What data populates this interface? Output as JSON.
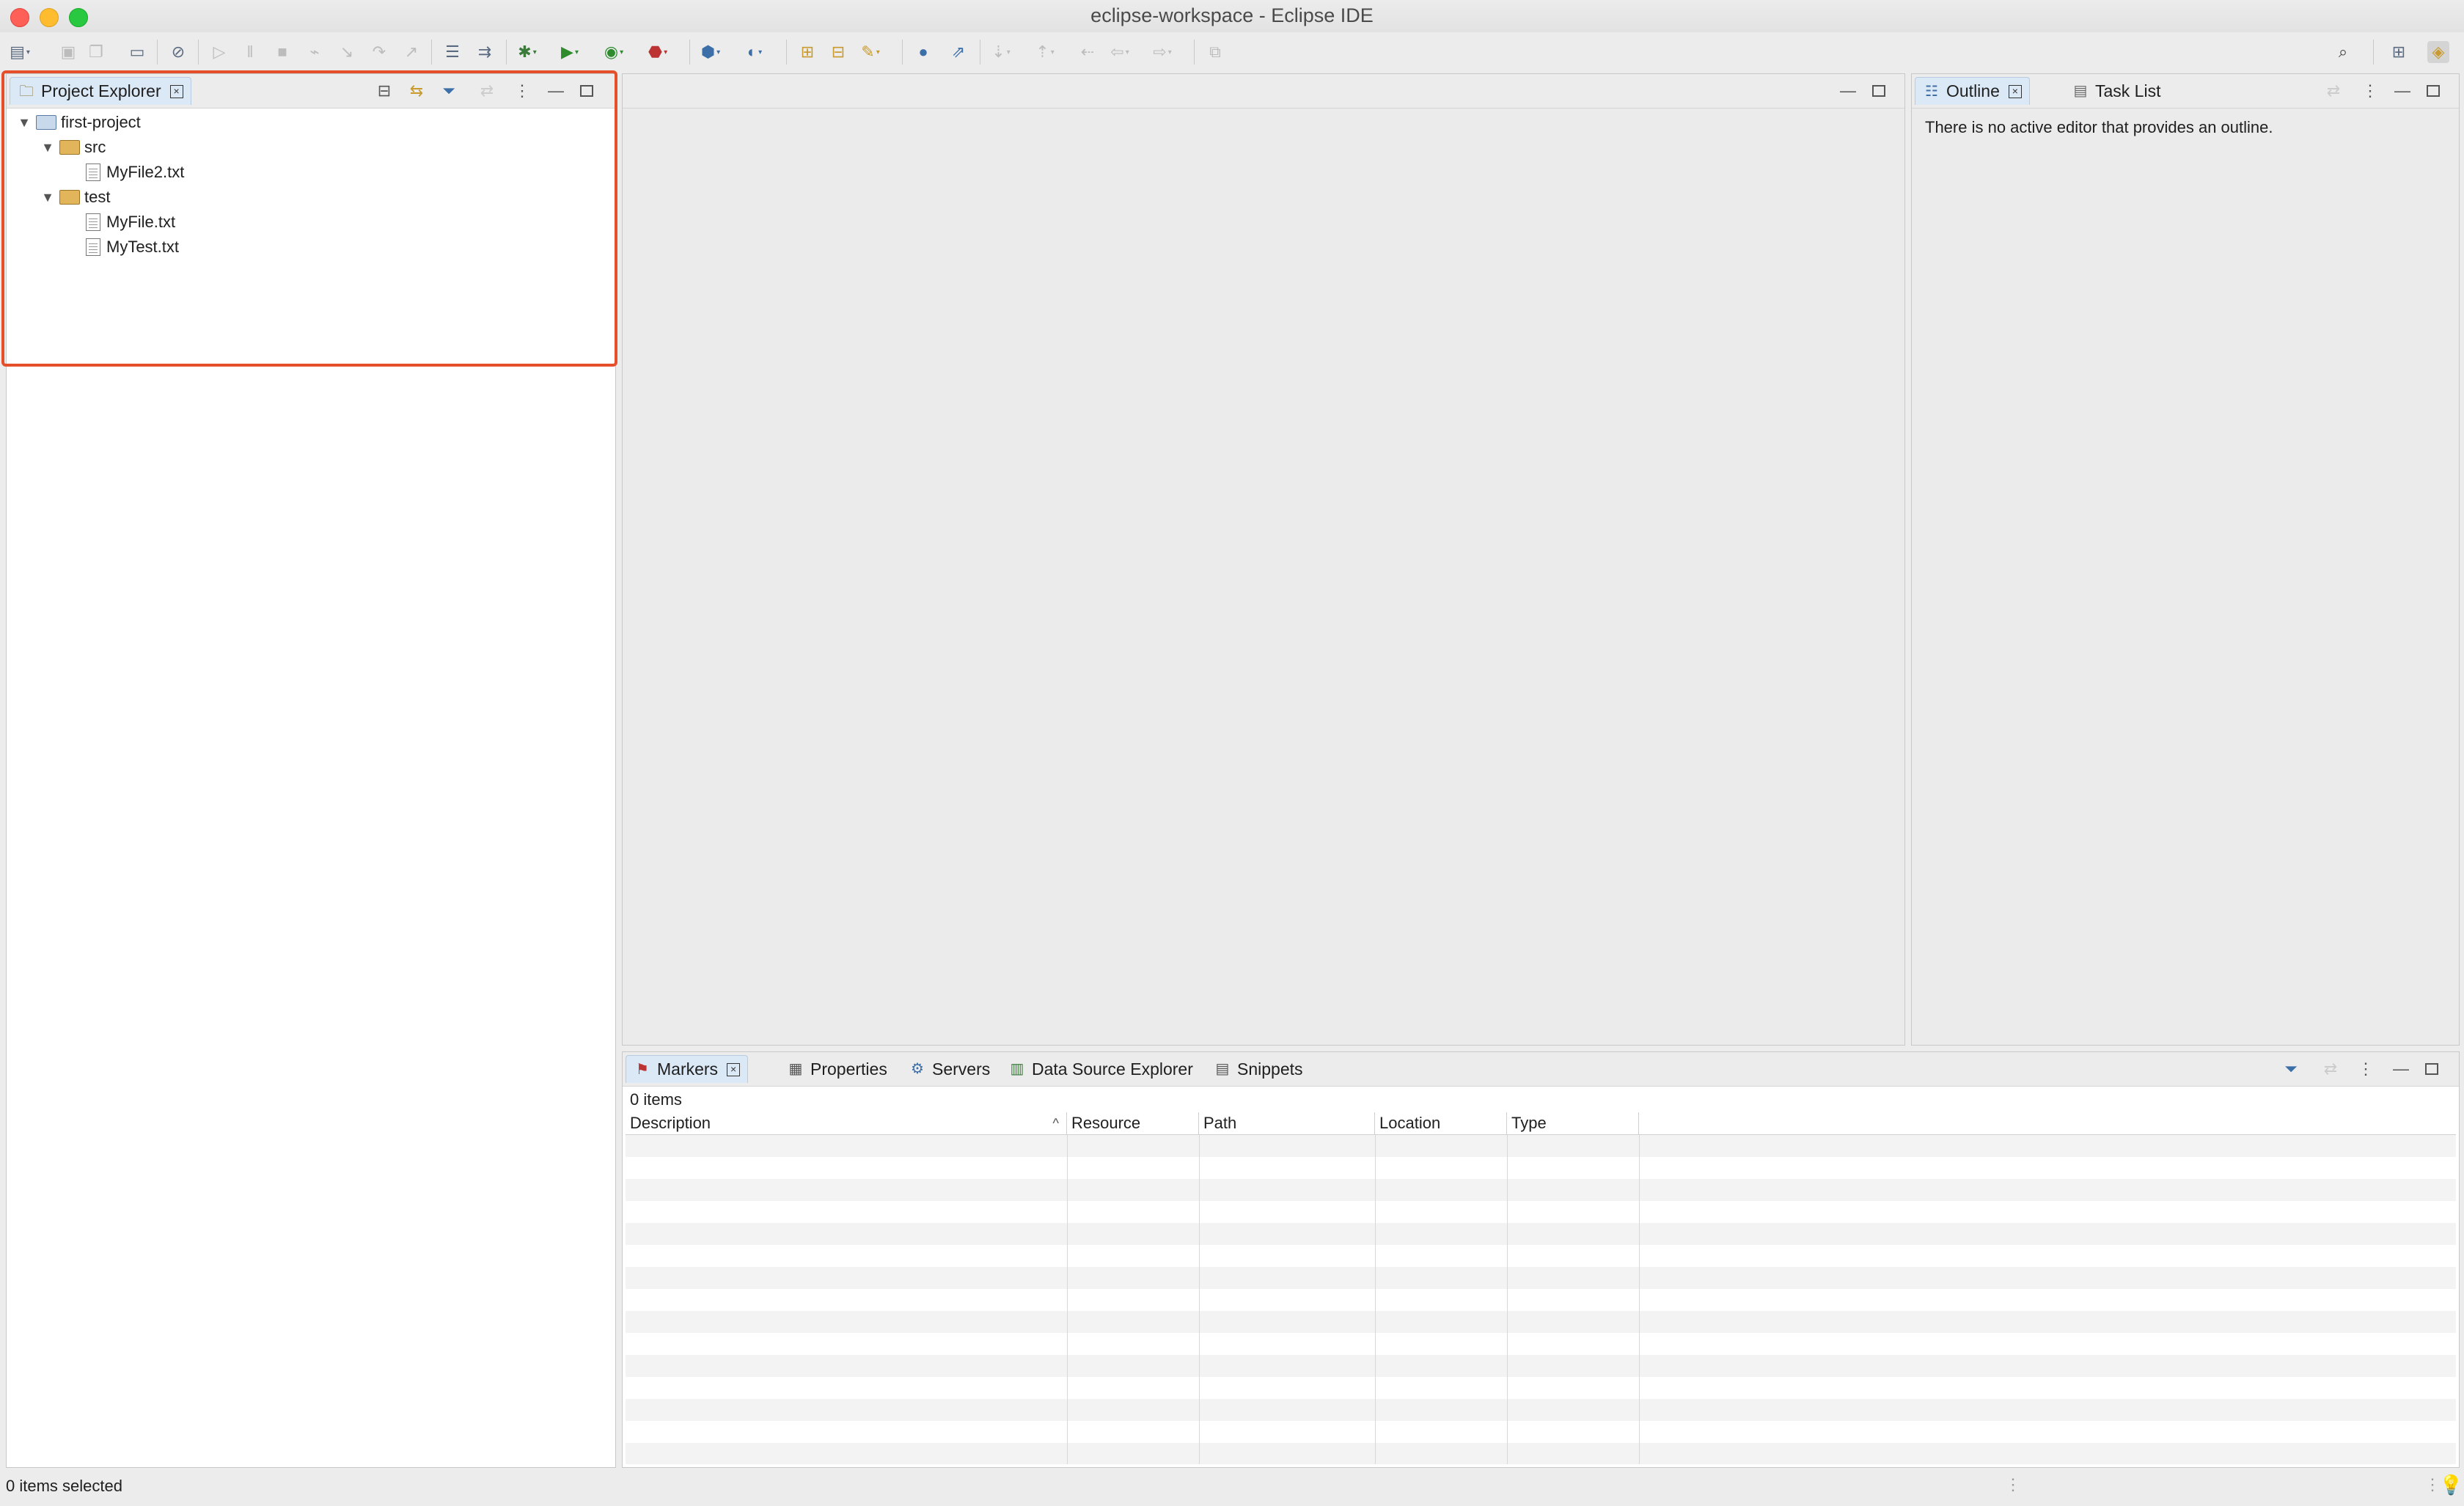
{
  "window": {
    "title": "eclipse-workspace - Eclipse IDE"
  },
  "project_explorer": {
    "tab_label": "Project Explorer",
    "tree": {
      "project": "first-project",
      "src_folder": "src",
      "src_files": [
        "MyFile2.txt"
      ],
      "test_folder": "test",
      "test_files": [
        "MyFile.txt",
        "MyTest.txt"
      ]
    }
  },
  "outline": {
    "tab_label": "Outline",
    "task_list_label": "Task List",
    "message": "There is no active editor that provides an outline."
  },
  "bottom_panel": {
    "tabs": [
      "Markers",
      "Properties",
      "Servers",
      "Data Source Explorer",
      "Snippets"
    ],
    "item_count": "0 items",
    "columns": [
      "Description",
      "Resource",
      "Path",
      "Location",
      "Type"
    ]
  },
  "status_bar": {
    "text": "0 items selected"
  },
  "colors": {
    "highlight": "#e5502a",
    "active_tab": "#dbe8f6"
  }
}
